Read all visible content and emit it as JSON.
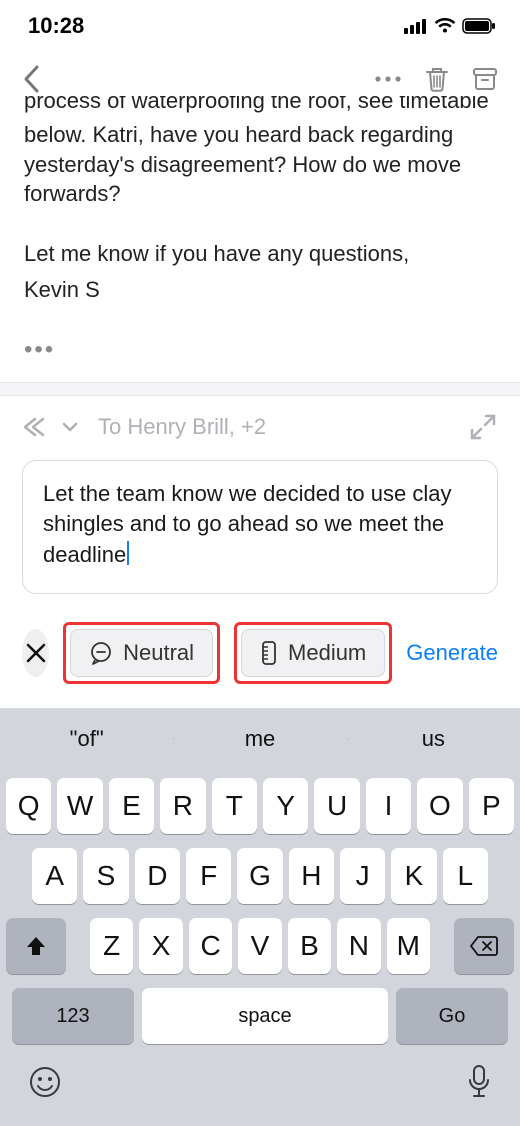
{
  "status": {
    "time": "10:28"
  },
  "email": {
    "cut_line": "process of waterproofing the roof, see timetable",
    "line1": "below. Katri, have you heard back regarding yesterday's disagreement? How do we move forwards?",
    "closing1": "Let me know if you have any questions,",
    "closing2": "Kevin S"
  },
  "reply": {
    "to_line": "To Henry Brill, +2"
  },
  "compose": {
    "text": "Let the team know we decided to use clay shingles and to go ahead so we meet the deadline"
  },
  "options": {
    "tone_label": "Neutral",
    "length_label": "Medium",
    "generate_label": "Generate"
  },
  "keyboard": {
    "suggestions": [
      "\"of\"",
      "me",
      "us"
    ],
    "row1": [
      "Q",
      "W",
      "E",
      "R",
      "T",
      "Y",
      "U",
      "I",
      "O",
      "P"
    ],
    "row2": [
      "A",
      "S",
      "D",
      "F",
      "G",
      "H",
      "J",
      "K",
      "L"
    ],
    "row3": [
      "Z",
      "X",
      "C",
      "V",
      "B",
      "N",
      "M"
    ],
    "numbers_label": "123",
    "space_label": "space",
    "go_label": "Go"
  }
}
